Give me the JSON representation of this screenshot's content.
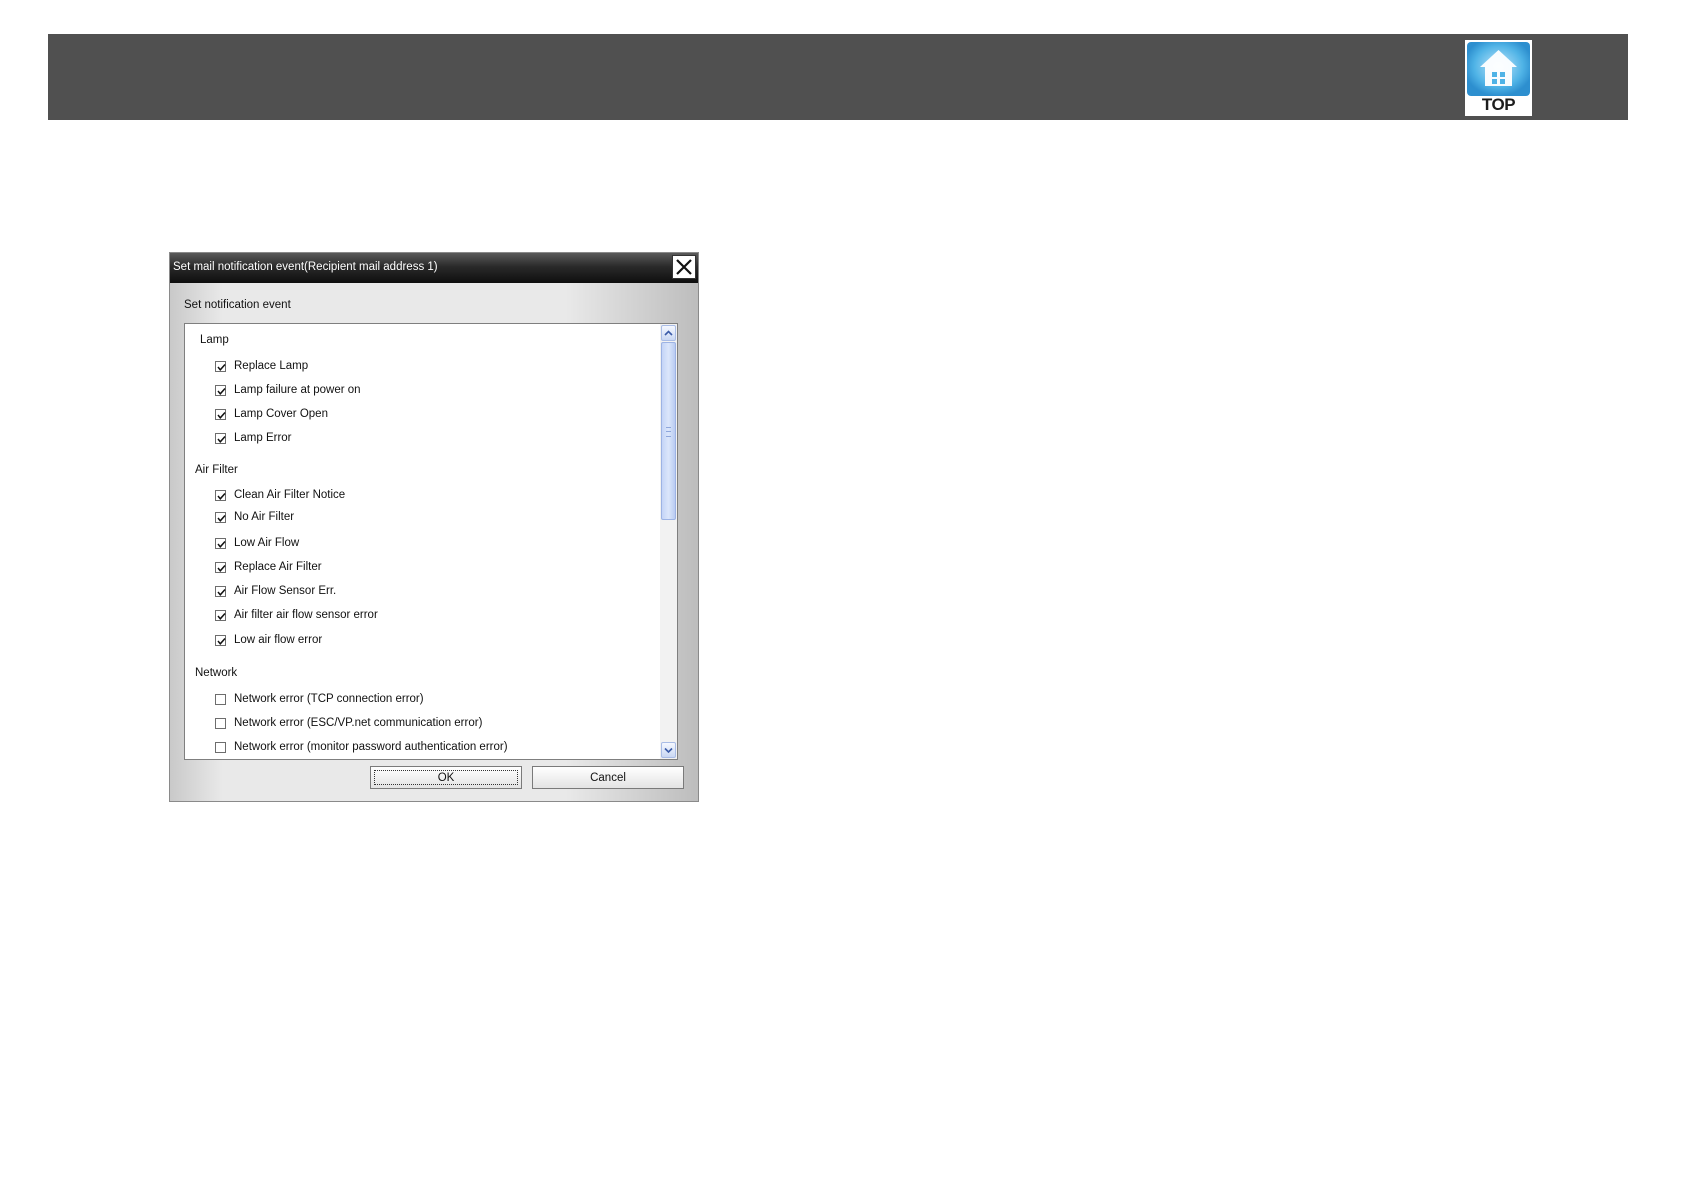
{
  "header": {
    "top_button_label": "TOP",
    "top_button_icon": "home-icon",
    "band_color": "#505050",
    "icon_color": "#4fb3e6"
  },
  "dialog": {
    "title": "Set mail notification event(Recipient mail address 1)",
    "section_title": "Set notification event",
    "groups": [
      {
        "label": "Lamp",
        "items": [
          {
            "label": "Replace Lamp",
            "checked": true
          },
          {
            "label": "Lamp failure at power on",
            "checked": true
          },
          {
            "label": "Lamp Cover Open",
            "checked": true
          },
          {
            "label": "Lamp Error",
            "checked": true
          }
        ]
      },
      {
        "label": "Air Filter",
        "items": [
          {
            "label": "Clean Air Filter Notice",
            "checked": true
          },
          {
            "label": "No Air Filter",
            "checked": true
          },
          {
            "label": "Low Air Flow",
            "checked": true
          },
          {
            "label": "Replace Air Filter",
            "checked": true
          },
          {
            "label": "Air Flow Sensor Err.",
            "checked": true
          },
          {
            "label": "Air filter air flow sensor error",
            "checked": true
          },
          {
            "label": "Low air flow error",
            "checked": true
          }
        ]
      },
      {
        "label": "Network",
        "items": [
          {
            "label": "Network error (TCP connection error)",
            "checked": false
          },
          {
            "label": "Network error (ESC/VP.net communication error)",
            "checked": false
          },
          {
            "label": "Network error (monitor password authentication error)",
            "checked": false
          }
        ]
      }
    ],
    "ok_label": "OK",
    "cancel_label": "Cancel"
  }
}
